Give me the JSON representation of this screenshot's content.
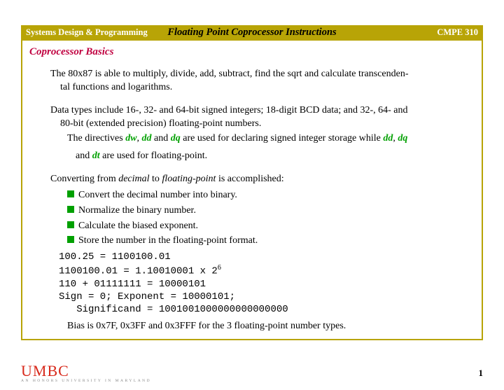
{
  "header": {
    "left": "Systems Design & Programming",
    "center": "Floating Point Coprocessor Instructions",
    "right": "CMPE 310"
  },
  "section_title": "Coprocessor Basics",
  "p1a": "The 80x87 is able to multiply, divide, add, subtract, find the sqrt and calculate transcenden-",
  "p1b": "tal functions and logarithms.",
  "p2a": "Data types include 16-, 32- and 64-bit signed integers; 18-digit BCD data; and 32-, 64- and",
  "p2b": "80-bit (extended precision) floating-point numbers.",
  "dir_line1_a": "The directives ",
  "dir_dw": "dw",
  "sep_comma": ", ",
  "dir_dd": "dd",
  "dir_and": " and ",
  "dir_dq": "dq",
  "dir_line1_b": " are used for declaring signed integer storage while ",
  "dir_line2_a": "and ",
  "dir_dt": "dt",
  "dir_line2_b": " are used for floating-point.",
  "conv_intro_a": "Converting from ",
  "conv_decimal": "decimal",
  "conv_to": " to ",
  "conv_fp": "floating-point",
  "conv_intro_b": " is accomplished:",
  "bullets": [
    "Convert the decimal number into binary.",
    "Normalize the binary number.",
    "Calculate the biased exponent.",
    "Store the number in the floating-point format."
  ],
  "code": {
    "l1": "100.25 = 1100100.01",
    "l2a": "1100100.01 = 1.10010001 x 2",
    "l2sup": "6",
    "l3": "110 + 01111111 = 10000101",
    "l4": "Sign = 0; Exponent = 10000101;",
    "l5": "   Significand = 1001001000000000000000"
  },
  "bias_line": "Bias is 0x7F, 0x3FF and 0x3FFF for the 3 floating-point number types.",
  "footer": {
    "logo": "UMBC",
    "tag": "AN HONORS UNIVERSITY IN MARYLAND",
    "page": "1"
  }
}
